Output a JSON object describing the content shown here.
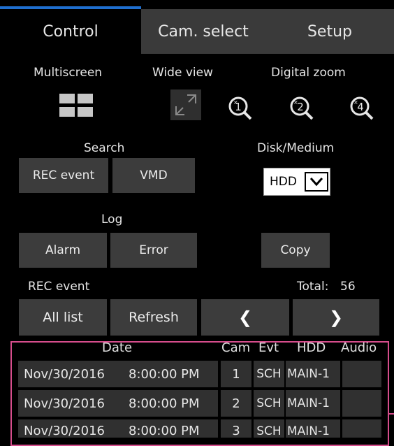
{
  "tabs": [
    {
      "label": "Control",
      "active": true
    },
    {
      "label": "Cam. select",
      "active": false
    },
    {
      "label": "Setup",
      "active": false
    }
  ],
  "control": {
    "multiscreen_label": "Multiscreen",
    "wideview_label": "Wide view",
    "digitalzoom_label": "Digital zoom",
    "zoom_buttons": [
      "x1",
      "x2",
      "x4"
    ],
    "search_label": "Search",
    "disk_label": "Disk/Medium",
    "rec_event_button": "REC event",
    "vmd_button": "VMD",
    "disk_select_value": "HDD",
    "log_label": "Log",
    "alarm_button": "Alarm",
    "error_button": "Error",
    "copy_button": "Copy",
    "rec_event_section_label": "REC event",
    "total_label": "Total:",
    "total_value": "56",
    "all_list_button": "All list",
    "refresh_button": "Refresh",
    "prev_glyph": "❮",
    "next_glyph": "❯"
  },
  "table": {
    "headers": {
      "date": "Date",
      "cam": "Cam",
      "evt": "Evt",
      "hdd": "HDD",
      "audio": "Audio"
    },
    "rows": [
      {
        "date": "Nov/30/2016",
        "time": "8:00:00 PM",
        "cam": "1",
        "evt": "SCH",
        "hdd": "MAIN-1",
        "audio": ""
      },
      {
        "date": "Nov/30/2016",
        "time": "8:00:00 PM",
        "cam": "2",
        "evt": "SCH",
        "hdd": "MAIN-1",
        "audio": ""
      },
      {
        "date": "Nov/30/2016",
        "time": "8:00:00 PM",
        "cam": "3",
        "evt": "SCH",
        "hdd": "MAIN-1",
        "audio": ""
      }
    ]
  },
  "colors": {
    "accent": "#1f6fd0",
    "highlight": "#d64d8c",
    "button": "#3c3c3c",
    "background": "#000000"
  }
}
